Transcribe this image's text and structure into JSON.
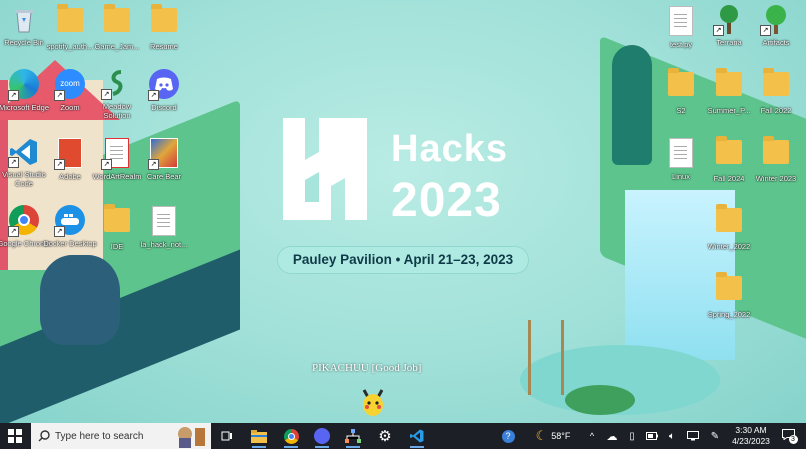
{
  "desktop": {
    "wallpaper": {
      "title": "Hacks",
      "year": "2023",
      "event_line": "Pauley Pavilion • April 21–23, 2023"
    },
    "overlay": {
      "pikachu_label": "PIKACHUU [Good Job]"
    },
    "icons": [
      {
        "label": "Recycle Bin",
        "icon": "recycle-bin-icon"
      },
      {
        "label": "spotify_auth...",
        "icon": "folder-icon"
      },
      {
        "label": "Game_Jam...",
        "icon": "folder-icon"
      },
      {
        "label": "Resume",
        "icon": "folder-icon"
      },
      {
        "label": "Microsoft Edge",
        "icon": "edge-icon"
      },
      {
        "label": "Zoom",
        "icon": "zoom-icon"
      },
      {
        "label": "Meadow Solution",
        "icon": "meadow-icon"
      },
      {
        "label": "Discord",
        "icon": "discord-icon"
      },
      {
        "label": "Visual Studio Code",
        "icon": "vscode-icon"
      },
      {
        "label": "Adobe",
        "icon": "adobe-icon"
      },
      {
        "label": "WordArtRealm",
        "icon": "wordart-icon"
      },
      {
        "label": "Care Bear",
        "icon": "carebear-icon"
      },
      {
        "label": "Google Chrome",
        "icon": "chrome-icon"
      },
      {
        "label": "Docker Desktop",
        "icon": "docker-icon"
      },
      {
        "label": "IDE",
        "icon": "folder-icon"
      },
      {
        "label": "la_hack_not...",
        "icon": "document-icon"
      },
      {
        "label": "test.py",
        "icon": "document-icon"
      },
      {
        "label": "Terraria",
        "icon": "terraria-icon"
      },
      {
        "label": "Artifacts",
        "icon": "tree-icon"
      },
      {
        "label": "S2",
        "icon": "folder-icon"
      },
      {
        "label": "Summer_P...",
        "icon": "folder-icon"
      },
      {
        "label": "Fall 2022",
        "icon": "folder-icon"
      },
      {
        "label": "Linux",
        "icon": "document-icon"
      },
      {
        "label": "Fall 2024",
        "icon": "folder-icon"
      },
      {
        "label": "Winter 2023",
        "icon": "folder-icon"
      },
      {
        "label": "Winter_2022",
        "icon": "folder-icon"
      },
      {
        "label": "Spring_2022",
        "icon": "folder-icon"
      }
    ]
  },
  "taskbar": {
    "search_placeholder": "Type here to search",
    "apps": [
      "file-explorer-icon",
      "chrome-icon",
      "discord-icon",
      "network-app-icon",
      "settings-icon",
      "vscode-icon"
    ],
    "weather": "58°F",
    "time": "3:30 AM",
    "date": "4/23/2023",
    "notification_count": "3"
  }
}
